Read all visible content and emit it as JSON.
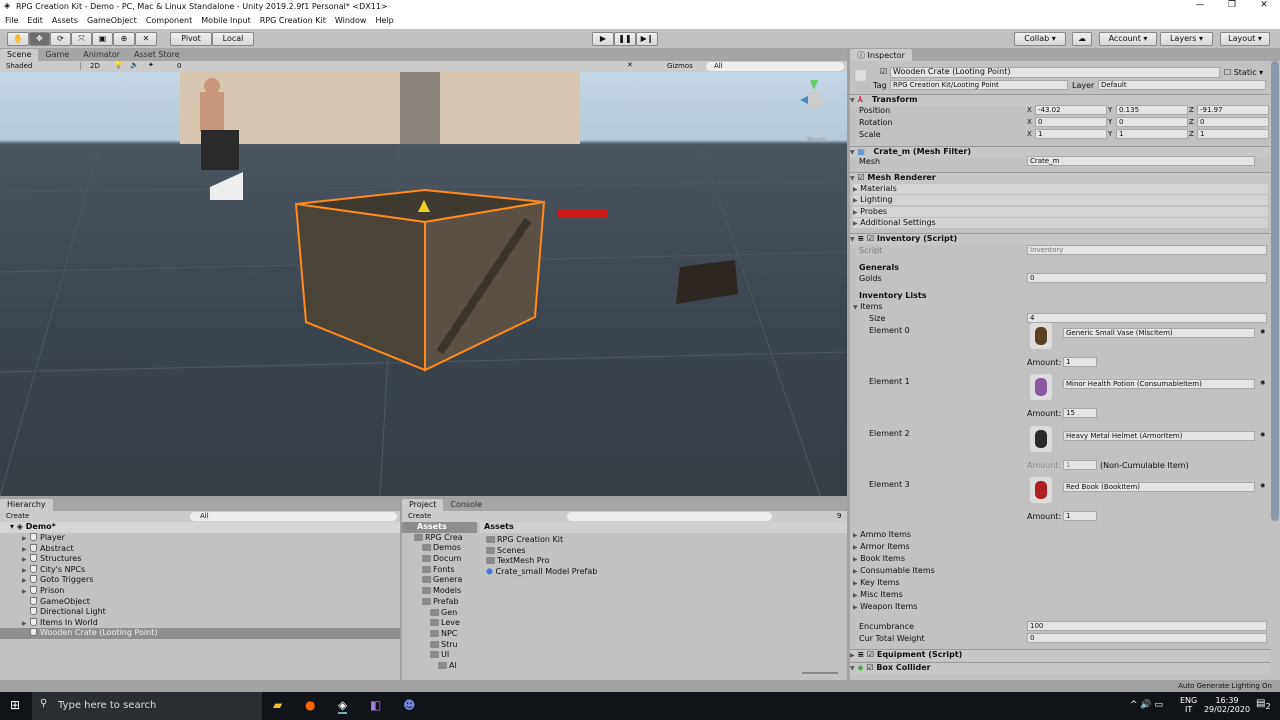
{
  "window": {
    "title": "RPG Creation Kit - Demo - PC, Mac & Linux Standalone - Unity 2019.2.9f1 Personal* <DX11>",
    "controls": [
      "—",
      "❐",
      "✕"
    ]
  },
  "menu": [
    "File",
    "Edit",
    "Assets",
    "GameObject",
    "Component",
    "Mobile Input",
    "RPG Creation Kit",
    "Window",
    "Help"
  ],
  "toolbar": {
    "tools": [
      "hand-tool",
      "move-tool",
      "rotate-tool",
      "scale-tool",
      "rect-tool",
      "transform-tool",
      "custom-tool"
    ],
    "pivot": "Pivot",
    "local": "Local",
    "play": "▶",
    "pause": "❚❚",
    "step": "▶❙",
    "collab": "Collab ▾",
    "account": "Account",
    "layers": "Layers",
    "layout": "Layout"
  },
  "scene": {
    "tabs": [
      "Scene",
      "Game",
      "Animator",
      "Asset Store"
    ],
    "shading": "Shaded",
    "mode2d": "2D",
    "gizmos": "Gizmos",
    "search": "All",
    "hidden_count": "0",
    "persp": "Persp"
  },
  "hierarchy": {
    "tab": "Hierarchy",
    "create": "Create",
    "search": "All",
    "scene": "Demo*",
    "items": [
      {
        "label": "Player",
        "expandable": true
      },
      {
        "label": "Abstract",
        "expandable": true
      },
      {
        "label": "Structures",
        "expandable": true
      },
      {
        "label": "City's NPCs",
        "expandable": true
      },
      {
        "label": "Goto Triggers",
        "expandable": true
      },
      {
        "label": "Prison",
        "expandable": true
      },
      {
        "label": "GameObject",
        "expandable": false
      },
      {
        "label": "Directional Light",
        "expandable": false
      },
      {
        "label": "Items In World",
        "expandable": true
      },
      {
        "label": "Wooden Crate (Looting Point)",
        "expandable": false,
        "selected": true
      }
    ]
  },
  "project": {
    "tabs": [
      "Project",
      "Console"
    ],
    "create": "Create",
    "hidden_count": "9",
    "tree": [
      {
        "label": "Assets",
        "depth": 0
      },
      {
        "label": "RPG Crea",
        "depth": 1
      },
      {
        "label": "Demos",
        "depth": 2
      },
      {
        "label": "Docum",
        "depth": 2
      },
      {
        "label": "Fonts",
        "depth": 2
      },
      {
        "label": "Genera",
        "depth": 2
      },
      {
        "label": "Models",
        "depth": 2
      },
      {
        "label": "Prefab",
        "depth": 2
      },
      {
        "label": "Gen",
        "depth": 3
      },
      {
        "label": "Leve",
        "depth": 3
      },
      {
        "label": "NPC",
        "depth": 3
      },
      {
        "label": "Stru",
        "depth": 3
      },
      {
        "label": "UI",
        "depth": 3
      },
      {
        "label": "Al",
        "depth": 4
      }
    ],
    "breadcrumb": "Assets",
    "assets": [
      "RPG Creation Kit",
      "Scenes",
      "TextMesh Pro",
      "Crate_small Model Prefab"
    ]
  },
  "inspector": {
    "tab": "Inspector",
    "name": "Wooden Crate (Looting Point)",
    "static": "Static",
    "tag_label": "Tag",
    "tag": "RPG Creation Kit/Looting Point",
    "layer_label": "Layer",
    "layer": "Default",
    "transform": {
      "title": "Transform",
      "position_label": "Position",
      "rotation_label": "Rotation",
      "scale_label": "Scale",
      "position": [
        "-43.02",
        "0.135",
        "-91.97"
      ],
      "rotation": [
        "0",
        "0",
        "0"
      ],
      "scale": [
        "1",
        "1",
        "1"
      ]
    },
    "mesh_filter": {
      "title": "Crate_m (Mesh Filter)",
      "mesh_label": "Mesh",
      "mesh": "Crate_m"
    },
    "mesh_renderer": {
      "title": "Mesh Renderer",
      "sections": [
        "Materials",
        "Lighting",
        "Probes",
        "Additional Settings"
      ]
    },
    "inventory": {
      "title": "Inventory (Script)",
      "script_label": "Script",
      "script": "Inventory",
      "generals": "Generals",
      "golds_label": "Golds",
      "golds": "0",
      "lists": "Inventory Lists",
      "items_label": "Items",
      "size_label": "Size",
      "size": "4",
      "amount_label": "Amount:",
      "elements": [
        {
          "label": "Element 0",
          "item": "Generic Small Vase (MiscItem)",
          "amount": "1",
          "note": "",
          "color": "#5a4020"
        },
        {
          "label": "Element 1",
          "item": "Minor Health Potion (ConsumableItem)",
          "amount": "15",
          "note": "",
          "color": "#8a5aa0"
        },
        {
          "label": "Element 2",
          "item": "Heavy Metal Helmet (ArmorItem)",
          "amount": "1",
          "note": "(Non-Cumulable Item)",
          "color": "#2a2a2a"
        },
        {
          "label": "Element 3",
          "item": "Red Book (BookItem)",
          "amount": "1",
          "note": "",
          "color": "#b02020"
        }
      ],
      "categories": [
        "Ammo Items",
        "Armor Items",
        "Book Items",
        "Consumable Items",
        "Key Items",
        "Misc Items",
        "Weapon Items"
      ],
      "encumbrance_label": "Encumbrance",
      "encumbrance": "100",
      "weight_label": "Cur Total Weight",
      "weight": "0"
    },
    "equipment": "Equipment (Script)",
    "box_collider": "Box Collider"
  },
  "status": "Auto Generate Lighting On",
  "taskbar": {
    "search": "Type here to search",
    "lang": "ENG",
    "region": "IT",
    "time": "16:39",
    "date": "29/02/2020",
    "notifications": "2"
  },
  "colors": {
    "selection_outline": "#ff8a1e",
    "accent": "#3d7bd6"
  }
}
